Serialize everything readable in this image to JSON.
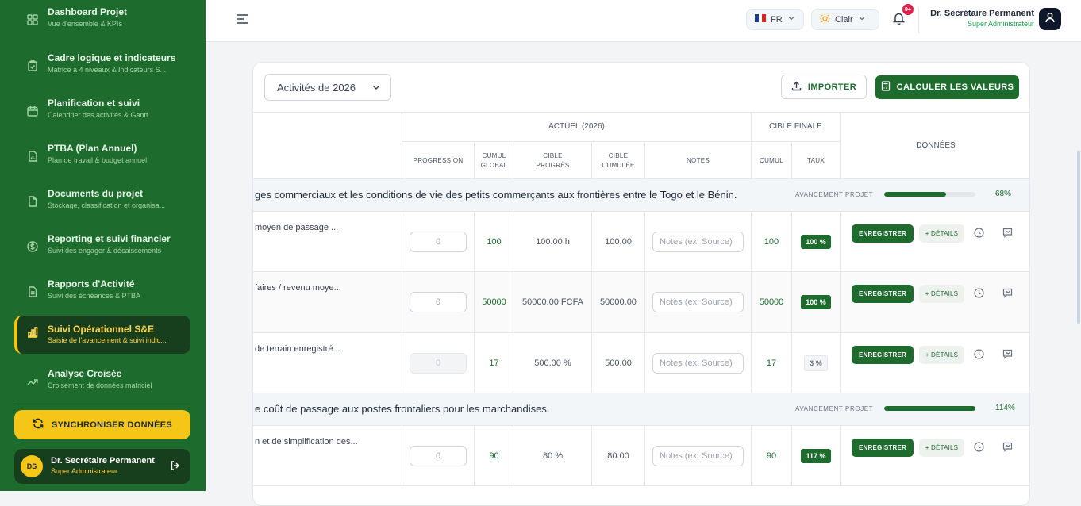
{
  "sidebar": {
    "items": [
      {
        "title": "Dashboard Projet",
        "subtitle": "Vue d'ensemble & KPIs",
        "icon": "grid-icon"
      },
      {
        "title": "Cadre logique et indicateurs",
        "subtitle": "Matrice à 4 niveaux & Indicateurs S...",
        "icon": "clipboard-icon"
      },
      {
        "title": "Planification et suivi",
        "subtitle": "Calendrier des activités & Gantt",
        "icon": "calendar-icon"
      },
      {
        "title": "PTBA (Plan Annuel)",
        "subtitle": "Plan de travail & budget annuel",
        "icon": "file-chart-icon"
      },
      {
        "title": "Documents du projet",
        "subtitle": "Stockage, classification et organisa...",
        "icon": "document-icon"
      },
      {
        "title": "Reporting et suivi financier",
        "subtitle": "Suivi des engager & décaissements",
        "icon": "dollar-icon"
      },
      {
        "title": "Rapports d'Activité",
        "subtitle": "Suivi des échéances & PTBA",
        "icon": "report-icon"
      },
      {
        "title": "Suivi Opérationnel S&E",
        "subtitle": "Saisie de l'avancement & suivi indic...",
        "icon": "bar-chart-icon"
      },
      {
        "title": "Analyse Croisée",
        "subtitle": "Croisement de données matriciel",
        "icon": "trend-icon"
      }
    ],
    "sync_label": "SYNCHRONISER DONNÉES",
    "user": {
      "initials": "DS",
      "name": "Dr. Secrétaire Permanent",
      "role": "Super Administrateur"
    }
  },
  "topbar": {
    "language": "FR",
    "theme": "Clair",
    "notif_badge": "9+",
    "user_name": "Dr. Secrétaire Permanent",
    "user_role": "Super Administrateur"
  },
  "toolbar": {
    "year_select": "Activités de 2026",
    "import_label": "IMPORTER",
    "calc_label": "CALCULER LES VALEURS"
  },
  "table": {
    "headers": {
      "actuel": "ACTUEL (2026)",
      "cible_finale": "CIBLE FINALE",
      "donnees": "DONNÉES",
      "progression": "PROGRESSION",
      "cumul_global": "CUMUL GLOBAL",
      "cible_progres": "CIBLE PROGRÈS",
      "cible_cumulee": "CIBLE CUMULÉE",
      "notes": "NOTES",
      "cumul": "CUMUL",
      "taux": "TAUX"
    },
    "sections": [
      {
        "title": "ges commerciaux et les conditions de vie des petits commerçants aux frontières entre le Togo et le Bénin.",
        "avancement_label": "AVANCEMENT PROJET",
        "pct": "68%",
        "progress": 0.68
      },
      {
        "title": "e coût de passage aux postes frontaliers pour les marchandises.",
        "avancement_label": "AVANCEMENT PROJET",
        "pct": "114%",
        "progress": 1.0
      }
    ],
    "rows": [
      {
        "name": "moyen de passage ...",
        "progression": "0",
        "cumul_global": "100",
        "cible_progres": "100.00 h",
        "cible_cumulee": "100.00",
        "notes_placeholder": "Notes (ex: Source)",
        "cumul": "100",
        "taux": "100 %",
        "enr": "ENREGISTRER",
        "det": "+ DÉTAILS"
      },
      {
        "name": "faires / revenu moye...",
        "progression": "0",
        "cumul_global": "50000",
        "cible_progres": "50000.00 FCFA",
        "cible_cumulee": "50000.00",
        "notes_placeholder": "Notes (ex: Source)",
        "cumul": "50000",
        "taux": "100 %",
        "enr": "ENREGISTRER",
        "det": "+ DÉTAILS"
      },
      {
        "name": "de terrain enregistré...",
        "progression": "0",
        "cumul_global": "17",
        "cible_progres": "500.00 %",
        "cible_cumulee": "500.00",
        "notes_placeholder": "Notes (ex: Source)",
        "cumul": "17",
        "taux": "3 %",
        "enr": "ENREGISTRER",
        "det": "+ DÉTAILS"
      },
      {
        "name": "n et de simplification des...",
        "progression": "0",
        "cumul_global": "90",
        "cible_progres": "80 %",
        "cible_cumulee": "80.00",
        "notes_placeholder": "Notes (ex: Source)",
        "cumul": "90",
        "taux": "117 %",
        "enr": "ENREGISTRER",
        "det": "+ DÉTAILS"
      }
    ]
  },
  "colors": {
    "primary": "#1e6b2e",
    "accent": "#f5c518"
  }
}
